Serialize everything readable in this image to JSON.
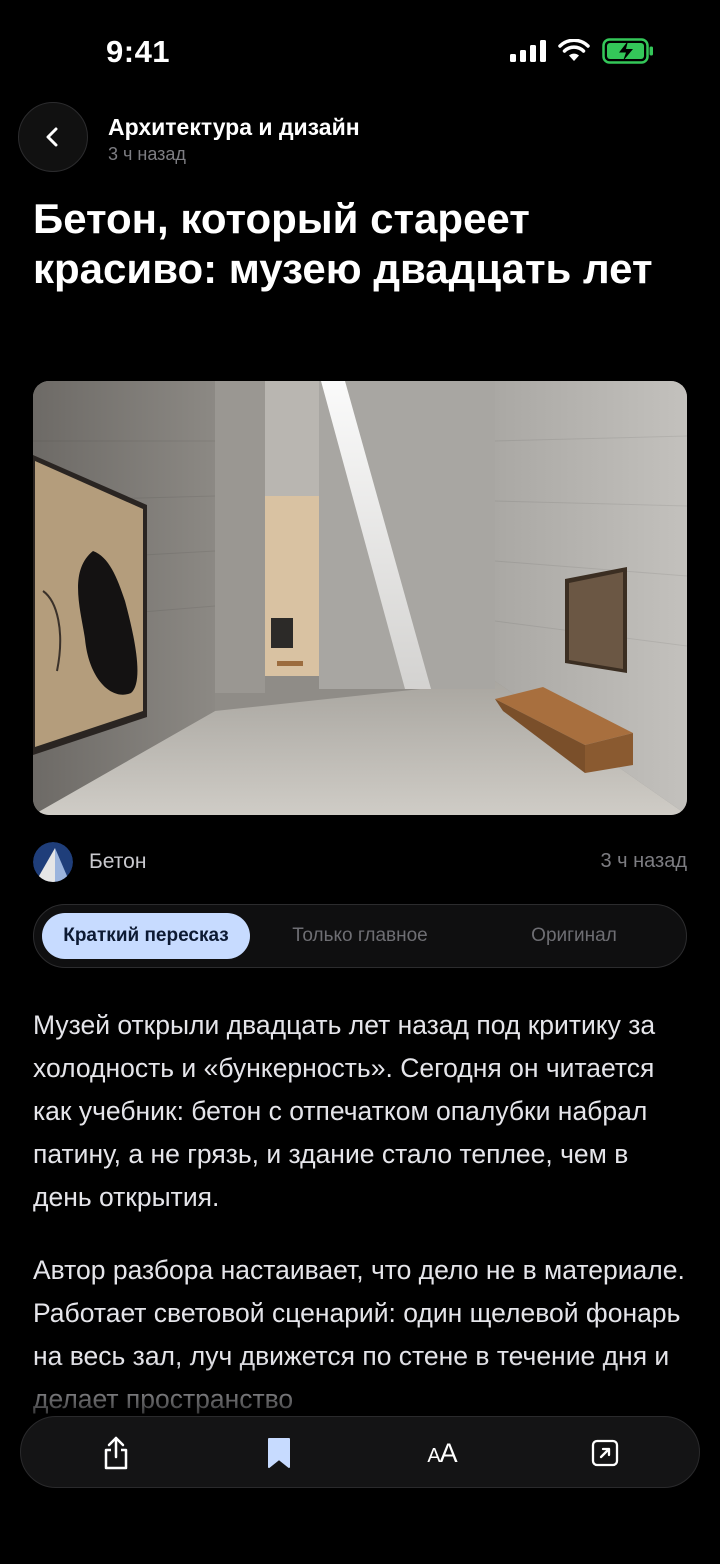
{
  "status_bar": {
    "time": "9:41"
  },
  "header": {
    "category": "Архитектура и дизайн",
    "time_ago": "3 ч назад"
  },
  "article": {
    "title": "Бетон, который стареет красиво: музею двадцать лет",
    "source_name": "Бетон",
    "source_time": "3 ч назад",
    "paragraphs": [
      "Музей открыли двадцать лет назад под критику за холодность и «бункерность». Сегодня он читается как учебник: бетон с отпечатком опалубки набрал патину, а не грязь, и здание стало теплее, чем в день открытия.",
      "Автор разбора настаивает, что дело не в материале. Работает световой сценарий: один щелевой фонарь на весь зал, луч движется по стене в течение дня и делает пространство"
    ]
  },
  "tabs": [
    {
      "label": "Краткий пересказ",
      "active": true
    },
    {
      "label": "Только главное",
      "active": false
    },
    {
      "label": "Оригинал",
      "active": false
    }
  ],
  "toolbar": {
    "text_size_label": "AA"
  },
  "icons": [
    "back-chevron-icon",
    "signal-icon",
    "wifi-icon",
    "battery-charging-icon",
    "share-icon",
    "bookmark-icon",
    "text-size-icon",
    "open-external-icon"
  ],
  "colors": {
    "accent": "#c7dbff",
    "battery": "#34c759",
    "background": "#000000"
  }
}
